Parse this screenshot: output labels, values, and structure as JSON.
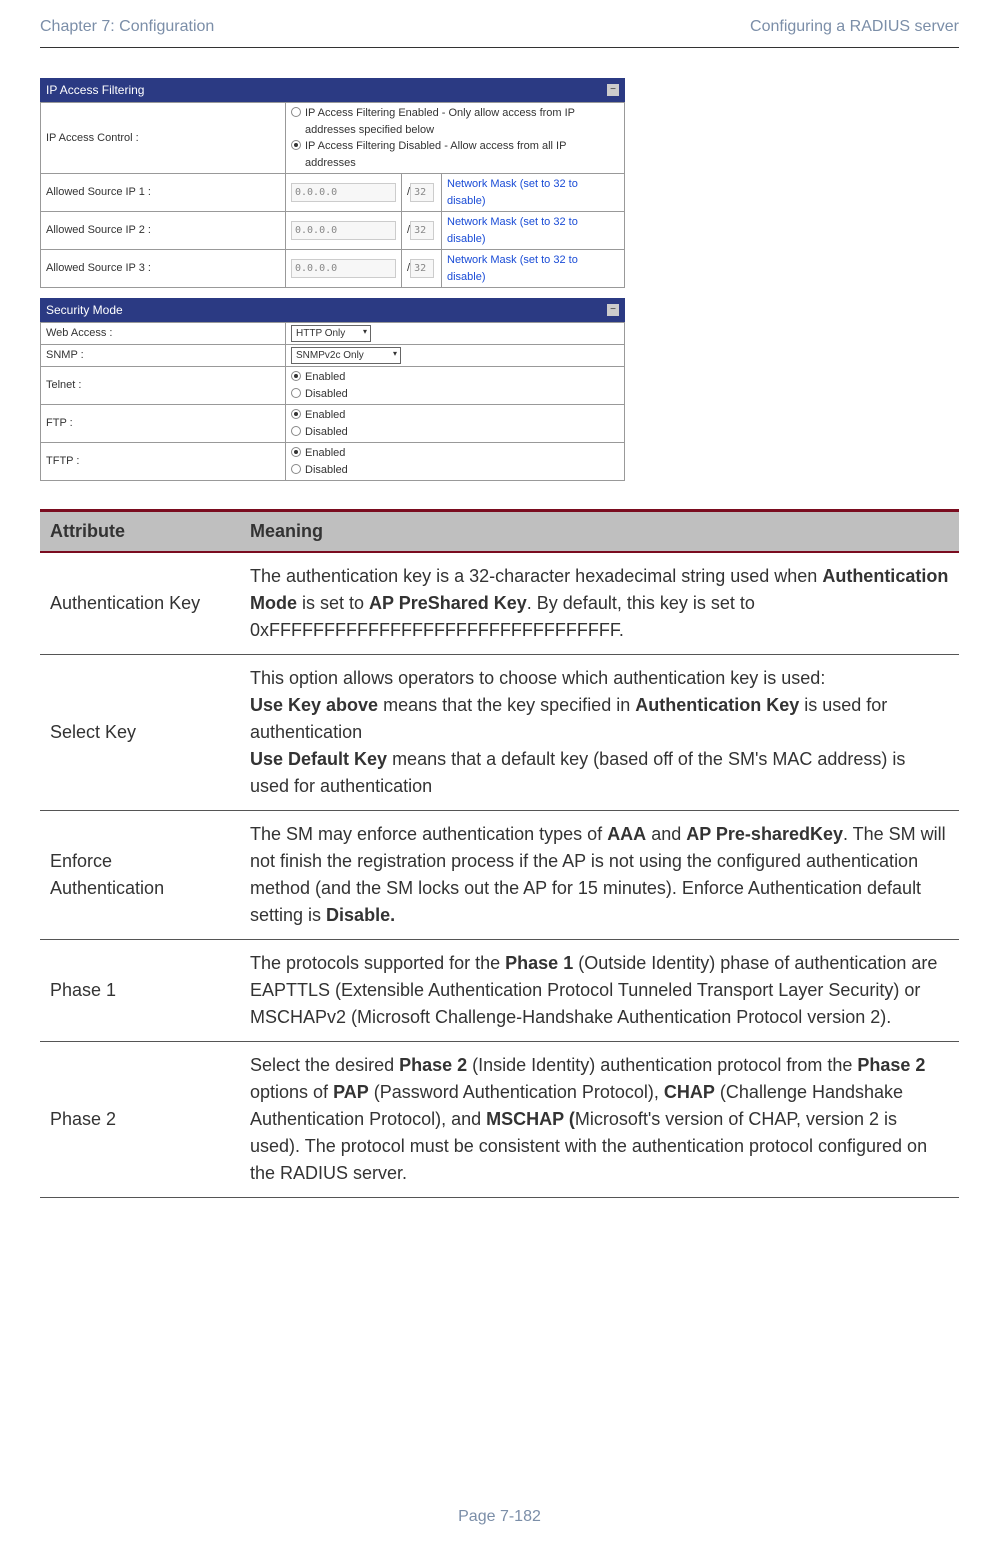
{
  "header": {
    "left": "Chapter 7:  Configuration",
    "right": "Configuring a RADIUS server"
  },
  "ip_panel": {
    "title": "IP Access Filtering",
    "control_label": "IP Access Control :",
    "opt1": "IP Access Filtering Enabled - Only allow access from IP addresses specified below",
    "opt2": "IP Access Filtering Disabled - Allow access from all IP addresses",
    "rows": [
      {
        "label": "Allowed Source IP 1 :",
        "ip": "0.0.0.0",
        "mask": "32",
        "desc": "Network Mask (set to 32 to disable)"
      },
      {
        "label": "Allowed Source IP 2 :",
        "ip": "0.0.0.0",
        "mask": "32",
        "desc": "Network Mask (set to 32 to disable)"
      },
      {
        "label": "Allowed Source IP 3 :",
        "ip": "0.0.0.0",
        "mask": "32",
        "desc": "Network Mask (set to 32 to disable)"
      }
    ]
  },
  "sec_panel": {
    "title": "Security Mode",
    "web": {
      "label": "Web Access :",
      "value": "HTTP Only"
    },
    "snmp": {
      "label": "SNMP :",
      "value": "SNMPv2c Only"
    },
    "telnet": {
      "label": "Telnet :",
      "e": "Enabled",
      "d": "Disabled"
    },
    "ftp": {
      "label": "FTP :",
      "e": "Enabled",
      "d": "Disabled"
    },
    "tftp": {
      "label": "TFTP :",
      "e": "Enabled",
      "d": "Disabled"
    }
  },
  "table": {
    "h1": "Attribute",
    "h2": "Meaning",
    "rows": [
      {
        "name": "Authentication Key",
        "m1": "The authentication key is a 32-character hexadecimal string used when ",
        "b1": "Authentication Mode",
        "m2": " is set to ",
        "b2": "AP PreShared Key",
        "m3": ". By default, this key is set to 0xFFFFFFFFFFFFFFFFFFFFFFFFFFFFFFFF."
      },
      {
        "name": "Select Key",
        "p1": "This option allows operators to choose which authentication key is used:",
        "b1": "Use Key above",
        "p2": " means that the key specified in ",
        "b2": "Authentication Key",
        "p3": " is used for authentication",
        "b3": "Use Default Key",
        "p4": " means that a default key (based off of the SM's MAC address) is used for authentication"
      },
      {
        "name": "Enforce Authentication",
        "p1": "The SM may enforce authentication types of ",
        "b1": "AAA",
        "p2": " and ",
        "b2": "AP Pre-sharedKey",
        "p3": ".  The SM will not finish the registration process if the AP is not using the configured authentication method (and the SM locks out the AP for 15 minutes). Enforce Authentication default setting is ",
        "b3": "Disable."
      },
      {
        "name": "Phase 1",
        "p1": "The protocols supported for the ",
        "b1": "Phase 1",
        "p2": " (Outside Identity) phase of authentication are EAPTTLS (Extensible Authentication Protocol Tunneled Transport Layer Security) or MSCHAPv2 (Microsoft Challenge-Handshake Authentication Protocol version 2)."
      },
      {
        "name": "Phase 2",
        "p1": "Select the desired ",
        "b1": "Phase 2",
        "p2": " (Inside Identity) authentication protocol from the ",
        "b2": "Phase 2",
        "p3": " options of ",
        "b3": "PAP",
        "p4": " (Password Authentication Protocol), ",
        "b4": "CHAP",
        "p5": " (Challenge Handshake Authentication Protocol), and ",
        "b5": "MSCHAP (",
        "p6": "Microsoft's version of CHAP, version 2 is used). The protocol must be consistent with the authentication protocol configured on the RADIUS server."
      }
    ]
  },
  "footer": "Page 7-182",
  "misc": {
    "slash": "/"
  }
}
